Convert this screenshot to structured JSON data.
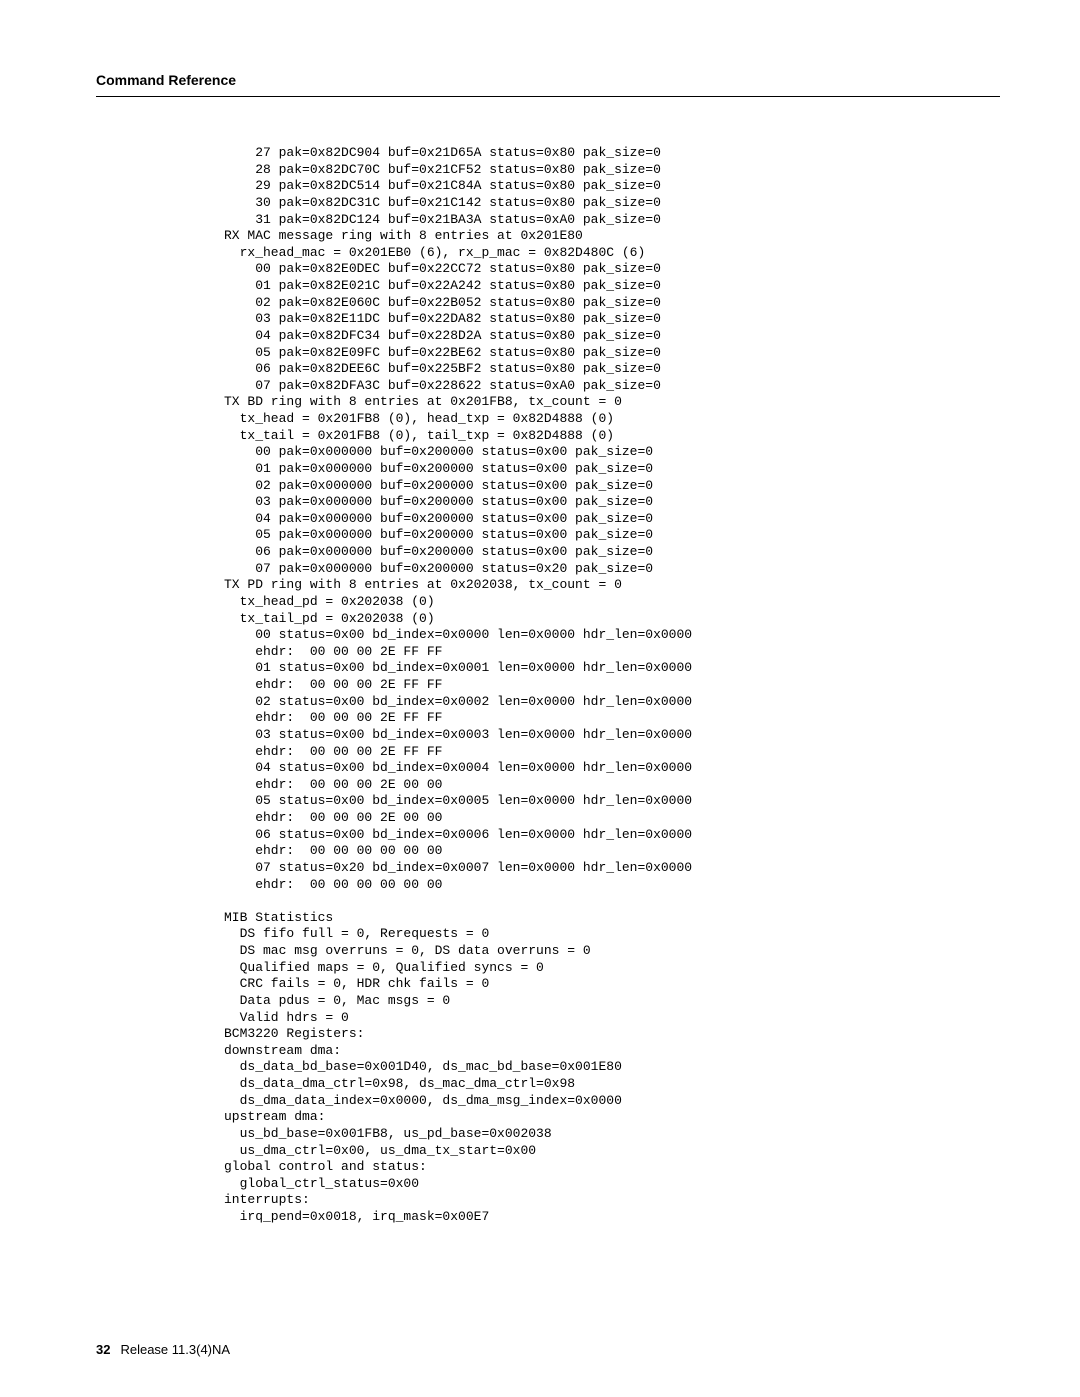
{
  "document": {
    "header_title": "Command Reference",
    "footer_page": "32",
    "footer_release": "Release 11.3(4)NA"
  },
  "output": {
    "lines": [
      "    27 pak=0x82DC904 buf=0x21D65A status=0x80 pak_size=0",
      "    28 pak=0x82DC70C buf=0x21CF52 status=0x80 pak_size=0",
      "    29 pak=0x82DC514 buf=0x21C84A status=0x80 pak_size=0",
      "    30 pak=0x82DC31C buf=0x21C142 status=0x80 pak_size=0",
      "    31 pak=0x82DC124 buf=0x21BA3A status=0xA0 pak_size=0",
      "RX MAC message ring with 8 entries at 0x201E80",
      "  rx_head_mac = 0x201EB0 (6), rx_p_mac = 0x82D480C (6)",
      "    00 pak=0x82E0DEC buf=0x22CC72 status=0x80 pak_size=0",
      "    01 pak=0x82E021C buf=0x22A242 status=0x80 pak_size=0",
      "    02 pak=0x82E060C buf=0x22B052 status=0x80 pak_size=0",
      "    03 pak=0x82E11DC buf=0x22DA82 status=0x80 pak_size=0",
      "    04 pak=0x82DFC34 buf=0x228D2A status=0x80 pak_size=0",
      "    05 pak=0x82E09FC buf=0x22BE62 status=0x80 pak_size=0",
      "    06 pak=0x82DEE6C buf=0x225BF2 status=0x80 pak_size=0",
      "    07 pak=0x82DFA3C buf=0x228622 status=0xA0 pak_size=0",
      "TX BD ring with 8 entries at 0x201FB8, tx_count = 0",
      "  tx_head = 0x201FB8 (0), head_txp = 0x82D4888 (0)",
      "  tx_tail = 0x201FB8 (0), tail_txp = 0x82D4888 (0)",
      "    00 pak=0x000000 buf=0x200000 status=0x00 pak_size=0",
      "    01 pak=0x000000 buf=0x200000 status=0x00 pak_size=0",
      "    02 pak=0x000000 buf=0x200000 status=0x00 pak_size=0",
      "    03 pak=0x000000 buf=0x200000 status=0x00 pak_size=0",
      "    04 pak=0x000000 buf=0x200000 status=0x00 pak_size=0",
      "    05 pak=0x000000 buf=0x200000 status=0x00 pak_size=0",
      "    06 pak=0x000000 buf=0x200000 status=0x00 pak_size=0",
      "    07 pak=0x000000 buf=0x200000 status=0x20 pak_size=0",
      "TX PD ring with 8 entries at 0x202038, tx_count = 0",
      "  tx_head_pd = 0x202038 (0)",
      "  tx_tail_pd = 0x202038 (0)",
      "    00 status=0x00 bd_index=0x0000 len=0x0000 hdr_len=0x0000",
      "    ehdr:  00 00 00 2E FF FF",
      "    01 status=0x00 bd_index=0x0001 len=0x0000 hdr_len=0x0000",
      "    ehdr:  00 00 00 2E FF FF",
      "    02 status=0x00 bd_index=0x0002 len=0x0000 hdr_len=0x0000",
      "    ehdr:  00 00 00 2E FF FF",
      "    03 status=0x00 bd_index=0x0003 len=0x0000 hdr_len=0x0000",
      "    ehdr:  00 00 00 2E FF FF",
      "    04 status=0x00 bd_index=0x0004 len=0x0000 hdr_len=0x0000",
      "    ehdr:  00 00 00 2E 00 00",
      "    05 status=0x00 bd_index=0x0005 len=0x0000 hdr_len=0x0000",
      "    ehdr:  00 00 00 2E 00 00",
      "    06 status=0x00 bd_index=0x0006 len=0x0000 hdr_len=0x0000",
      "    ehdr:  00 00 00 00 00 00",
      "    07 status=0x20 bd_index=0x0007 len=0x0000 hdr_len=0x0000",
      "    ehdr:  00 00 00 00 00 00",
      "",
      "MIB Statistics",
      "  DS fifo full = 0, Rerequests = 0",
      "  DS mac msg overruns = 0, DS data overruns = 0",
      "  Qualified maps = 0, Qualified syncs = 0",
      "  CRC fails = 0, HDR chk fails = 0",
      "  Data pdus = 0, Mac msgs = 0",
      "  Valid hdrs = 0",
      "BCM3220 Registers:",
      "downstream dma:",
      "  ds_data_bd_base=0x001D40, ds_mac_bd_base=0x001E80",
      "  ds_data_dma_ctrl=0x98, ds_mac_dma_ctrl=0x98",
      "  ds_dma_data_index=0x0000, ds_dma_msg_index=0x0000",
      "upstream dma:",
      "  us_bd_base=0x001FB8, us_pd_base=0x002038",
      "  us_dma_ctrl=0x00, us_dma_tx_start=0x00",
      "global control and status:",
      "  global_ctrl_status=0x00",
      "interrupts:",
      "  irq_pend=0x0018, irq_mask=0x00E7"
    ]
  }
}
